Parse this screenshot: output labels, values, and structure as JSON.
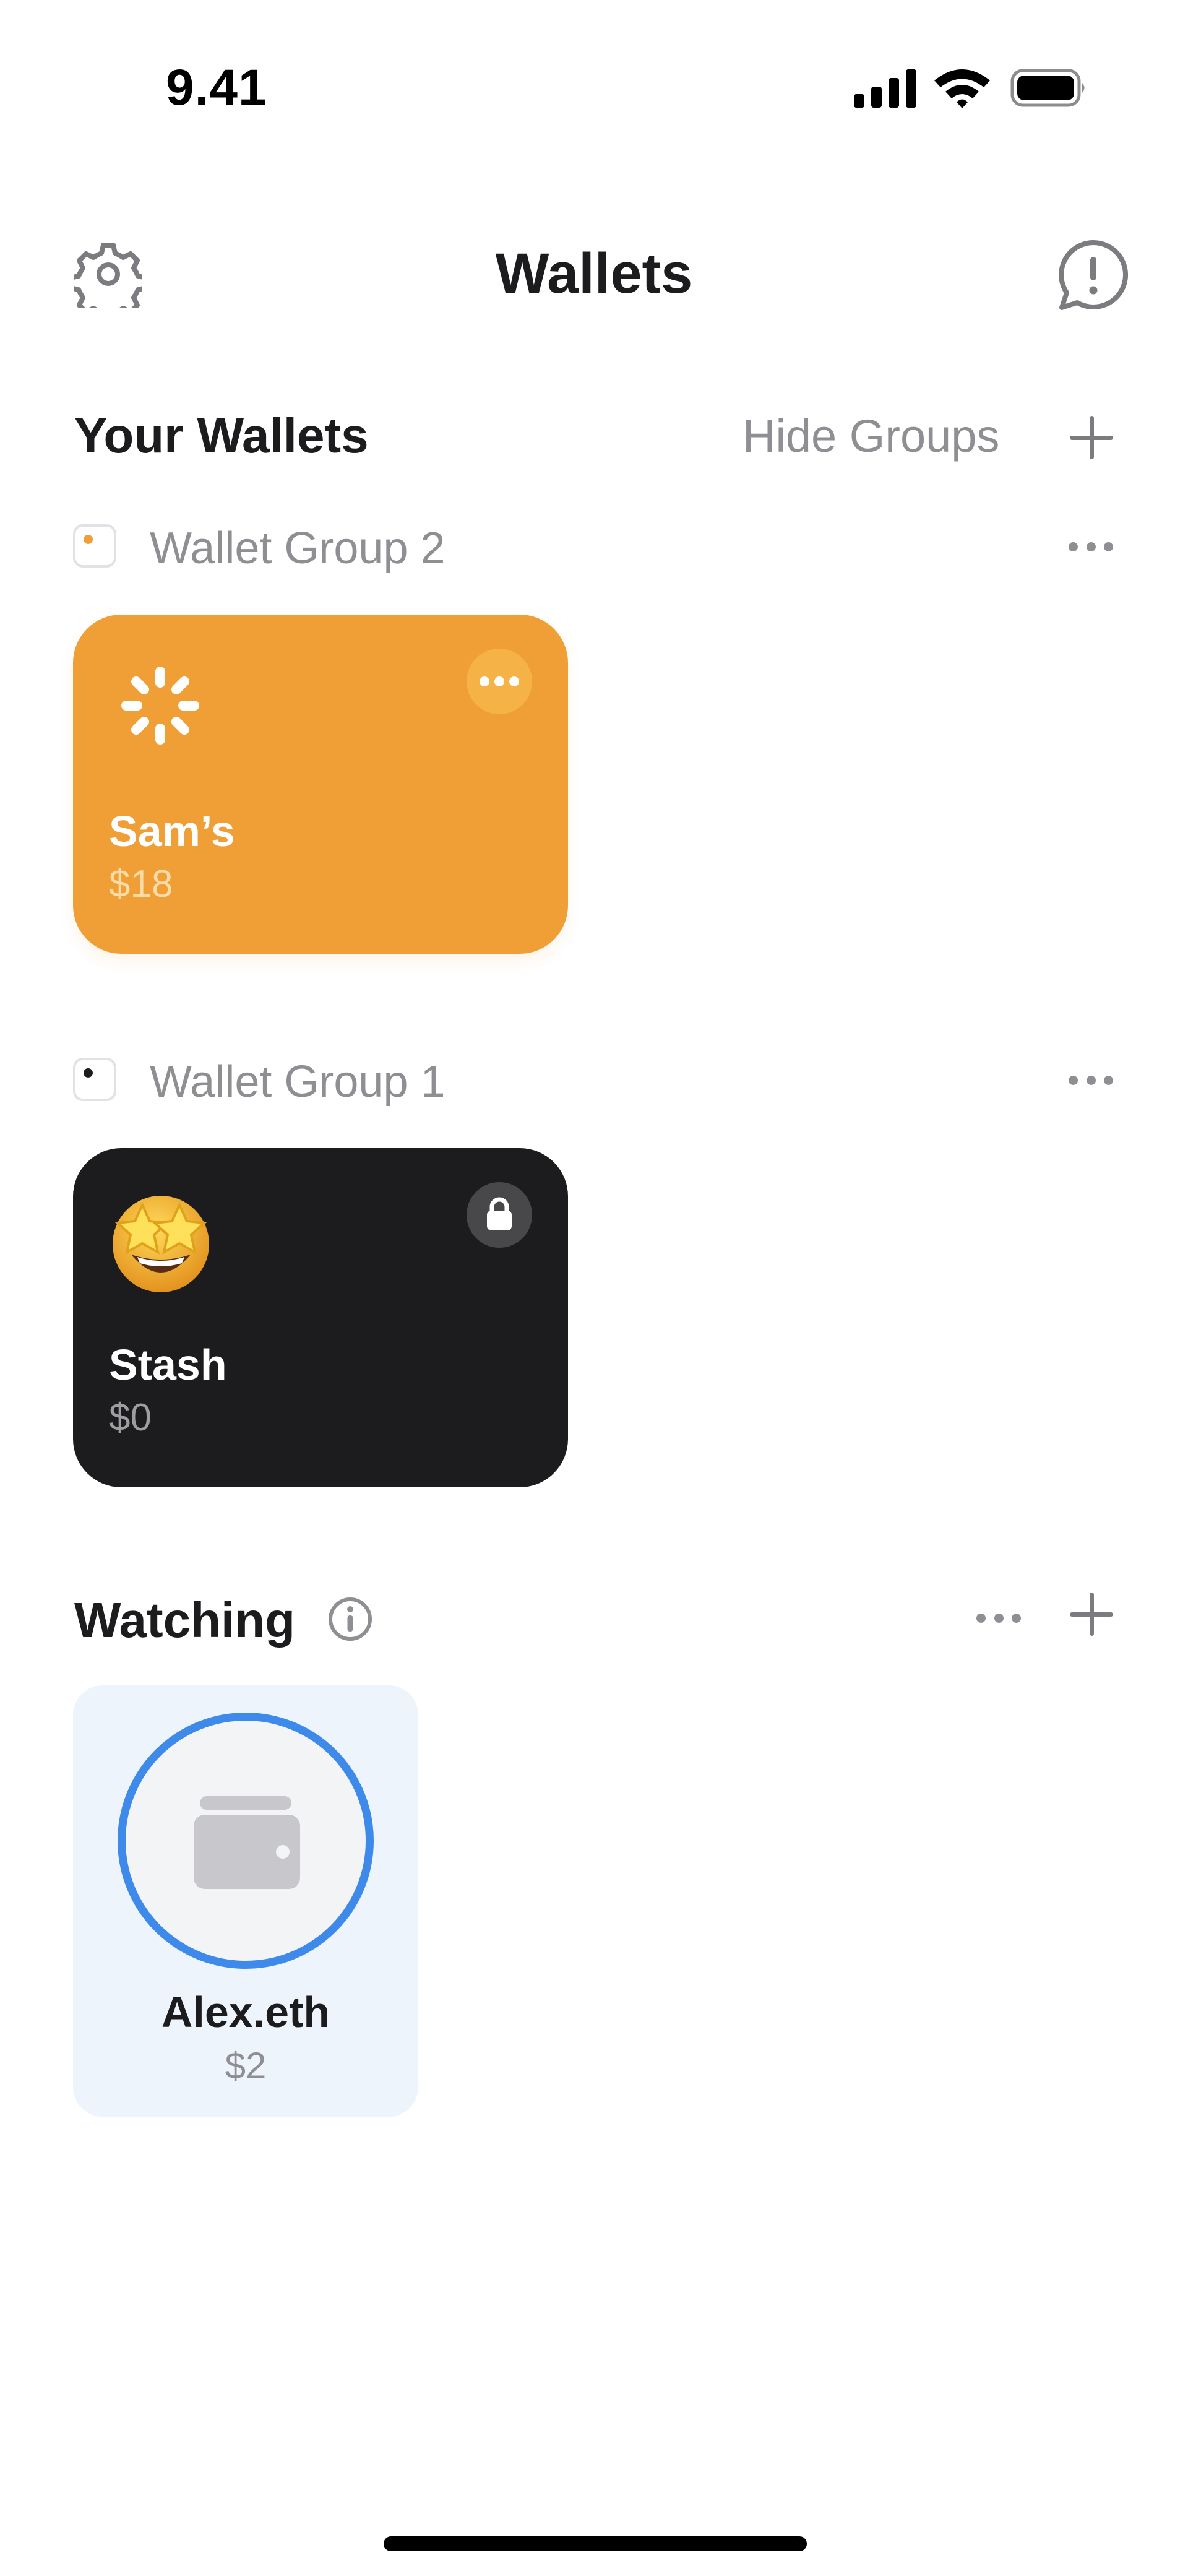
{
  "status_bar": {
    "time": "9.41"
  },
  "header": {
    "title": "Wallets"
  },
  "your_wallets": {
    "title": "Your Wallets",
    "hide_groups_label": "Hide Groups",
    "groups": [
      {
        "label": "Wallet Group 2",
        "color": "#f09e36",
        "wallets": [
          {
            "name": "Sam’s",
            "balance": "$18",
            "icon": "loading-spinner-icon",
            "color": "#f09e36"
          }
        ]
      },
      {
        "label": "Wallet Group 1",
        "color": "#1c1c1e",
        "wallets": [
          {
            "name": "Stash",
            "balance": "$0",
            "icon": "star-struck-emoji",
            "color": "#1c1c1e",
            "locked": true
          }
        ]
      }
    ]
  },
  "watching": {
    "title": "Watching",
    "items": [
      {
        "name": "Alex.eth",
        "balance": "$2",
        "icon": "wallet-icon"
      }
    ]
  },
  "colors": {
    "accent_blue": "#3e8aeb",
    "secondary_text": "#8e8e93",
    "orange": "#f09e36"
  }
}
